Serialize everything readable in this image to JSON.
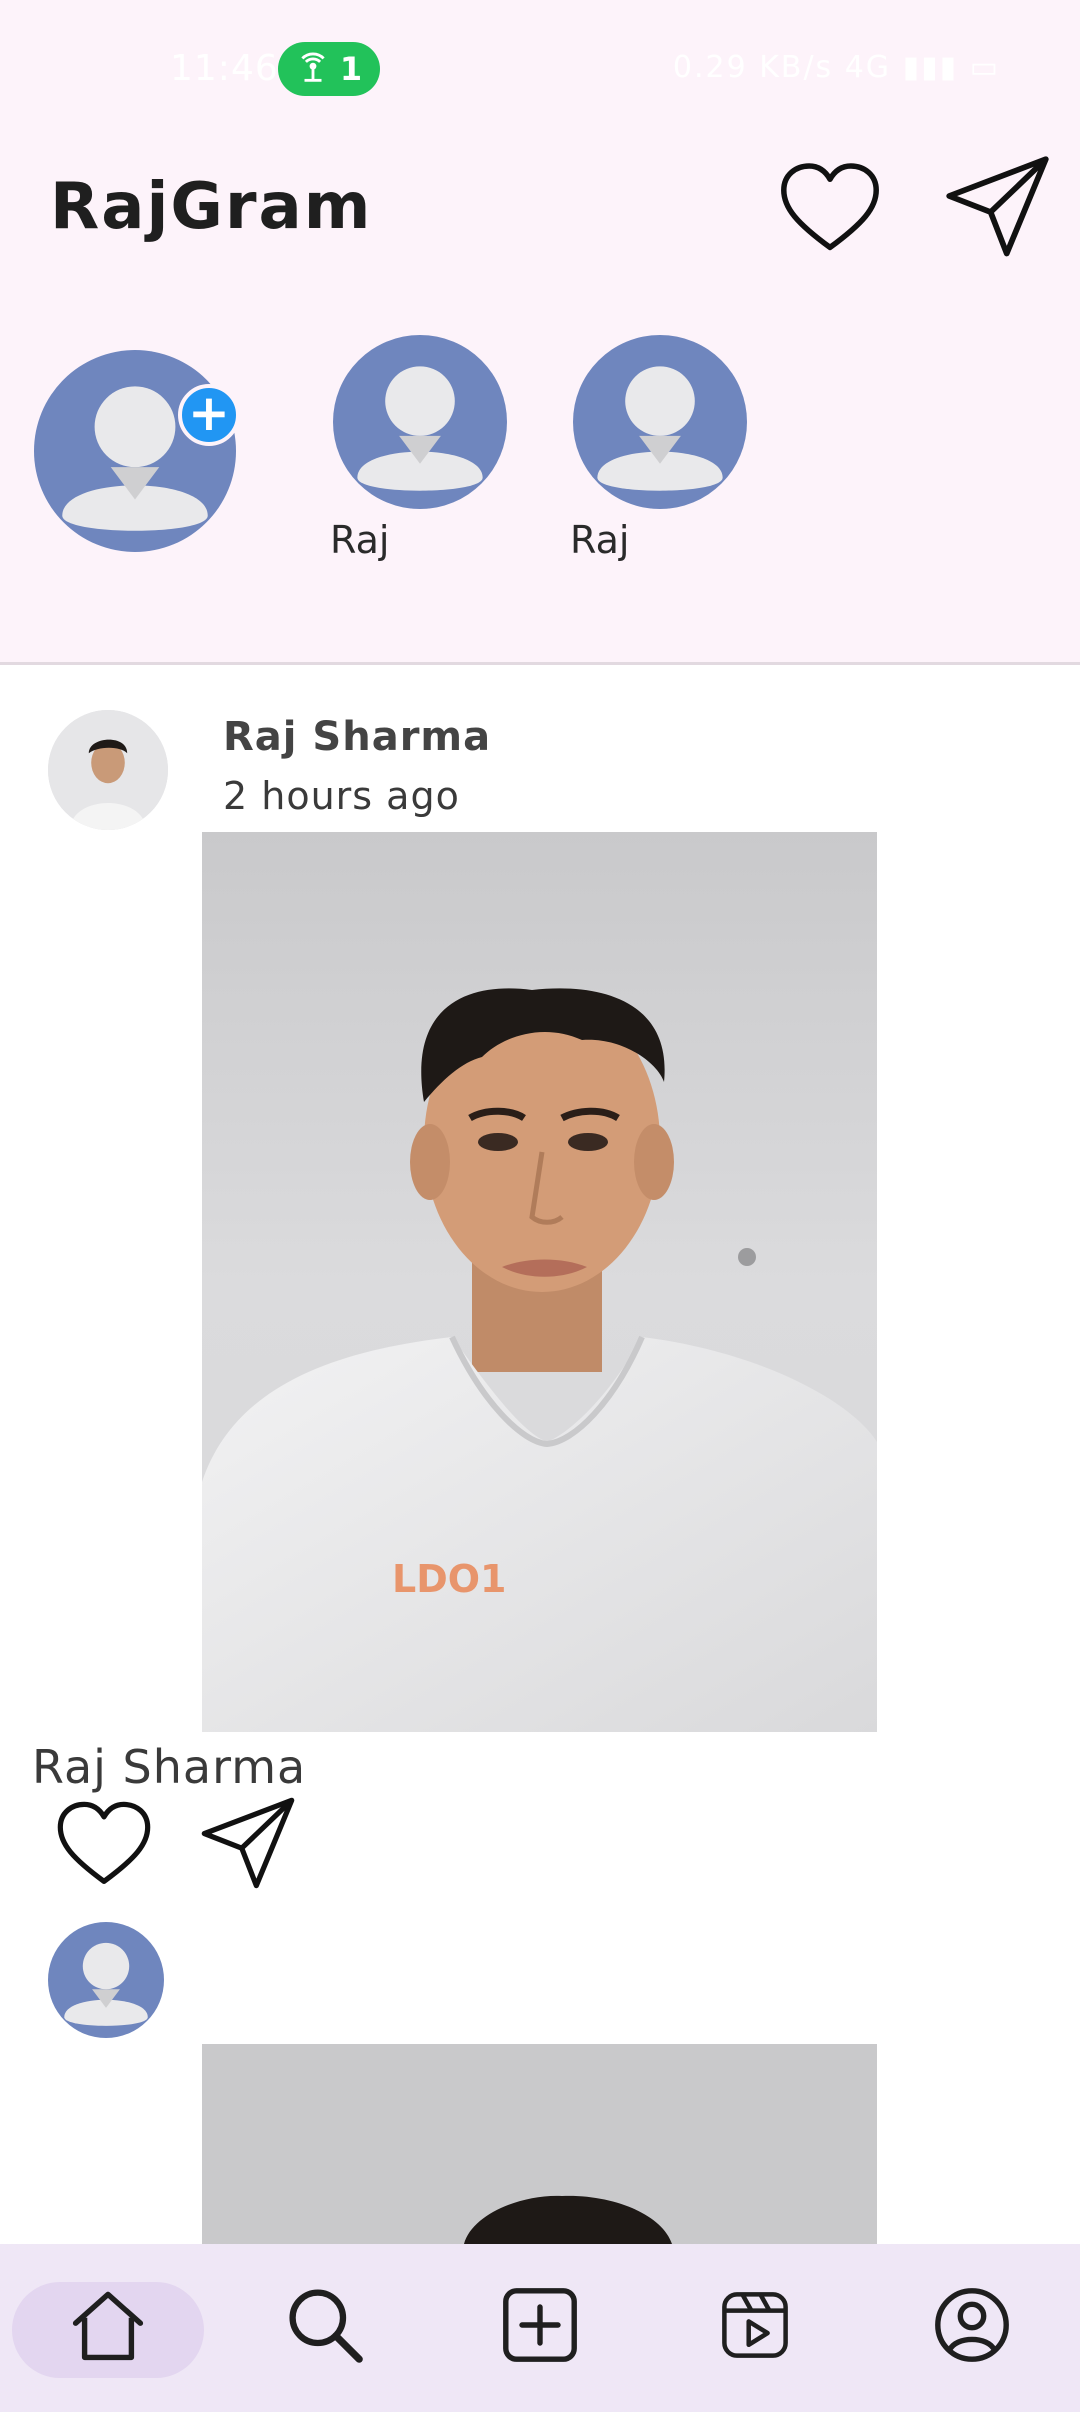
{
  "status_bar": {
    "time": "11:46",
    "hotspot_count": "1",
    "indicators": "0.29 KB/s  4G  ▮▮▮  ▭"
  },
  "header": {
    "title": "RajGram",
    "icons": [
      "heart-icon",
      "send-icon"
    ]
  },
  "stories": [
    {
      "label": "",
      "type": "add-story"
    },
    {
      "label": "Raj"
    },
    {
      "label": "Raj"
    }
  ],
  "posts": [
    {
      "author": "Raj Sharma",
      "time": "2 hours ago",
      "caption": "Raj Sharma",
      "tshirt_print": "LDO1"
    },
    {
      "author": "",
      "time": "",
      "caption": ""
    }
  ],
  "bottom_nav": {
    "items": [
      "home-icon",
      "search-icon",
      "add-post-icon",
      "reels-icon",
      "profile-icon"
    ],
    "active": "home-icon"
  },
  "colors": {
    "header_bg": "#FDF3FA",
    "avatar_bg": "#6F86BE",
    "add_badge": "#2196F3",
    "hotspot": "#22C25A",
    "nav_bg": "#EFE7F6",
    "nav_active": "#E3D6F0"
  }
}
